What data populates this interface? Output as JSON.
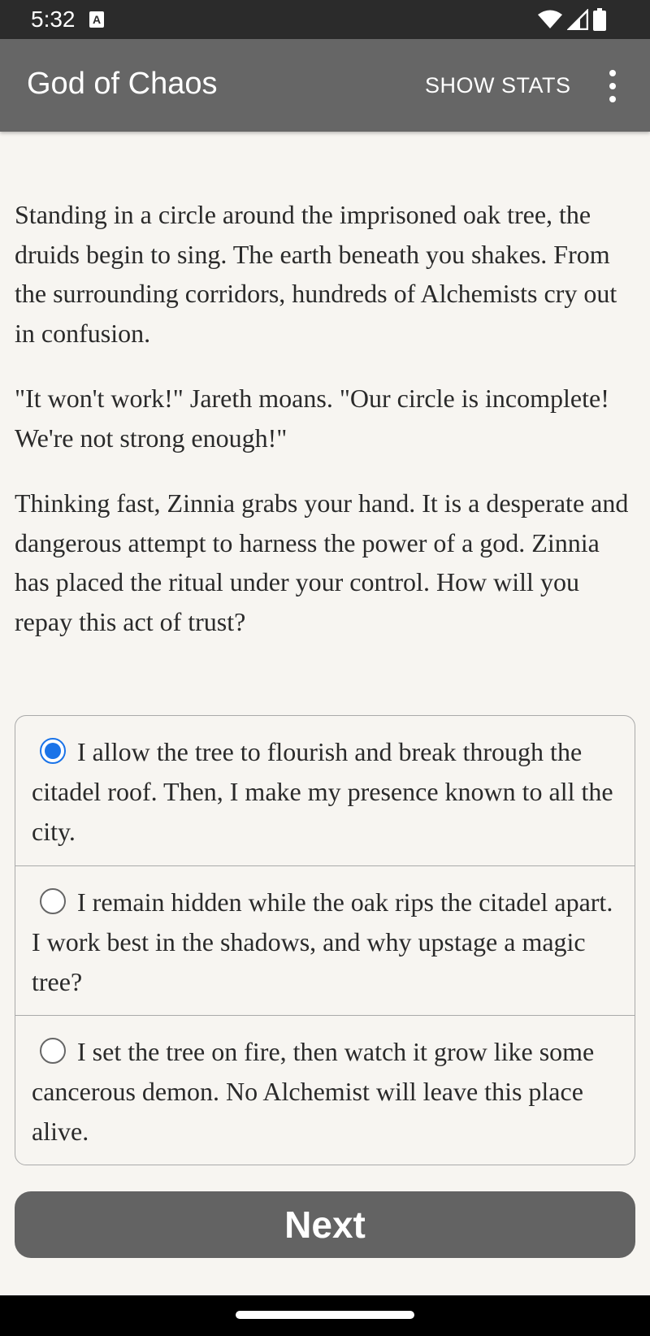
{
  "status_bar": {
    "time": "5:32",
    "notification_icon": "a-letter-icon",
    "icons": [
      "wifi-icon",
      "signal-icon",
      "battery-icon"
    ]
  },
  "app_bar": {
    "title": "God of Chaos",
    "show_stats_label": "SHOW STATS",
    "menu_icon": "more-vert-icon"
  },
  "story": {
    "paragraphs": [
      "Standing in a circle around the imprisoned oak tree, the druids begin to sing. The earth beneath you shakes. From the surrounding corridors, hundreds of Alchemists cry out in confusion.",
      "\"It won't work!\" Jareth moans. \"Our circle is incomplete! We're not strong enough!\"",
      "Thinking fast, Zinnia grabs your hand. It is a desperate and dangerous attempt to harness the power of a god. Zinnia has placed the ritual under your control. How will you repay this act of trust?"
    ]
  },
  "choices": [
    {
      "text": "I allow the tree to flourish and break through the citadel roof. Then, I make my presence known to all the city.",
      "selected": true
    },
    {
      "text": "I remain hidden while the oak rips the citadel apart. I work best in the shadows, and why upstage a magic tree?",
      "selected": false
    },
    {
      "text": "I set the tree on fire, then watch it grow like some cancerous demon. No Alchemist will leave this place alive.",
      "selected": false
    }
  ],
  "next_label": "Next",
  "colors": {
    "app_bar": "#666666",
    "status_bar": "#2b2b2b",
    "background": "#f7f5f1",
    "radio_selected": "#1a73e8",
    "next_button": "#636363"
  }
}
